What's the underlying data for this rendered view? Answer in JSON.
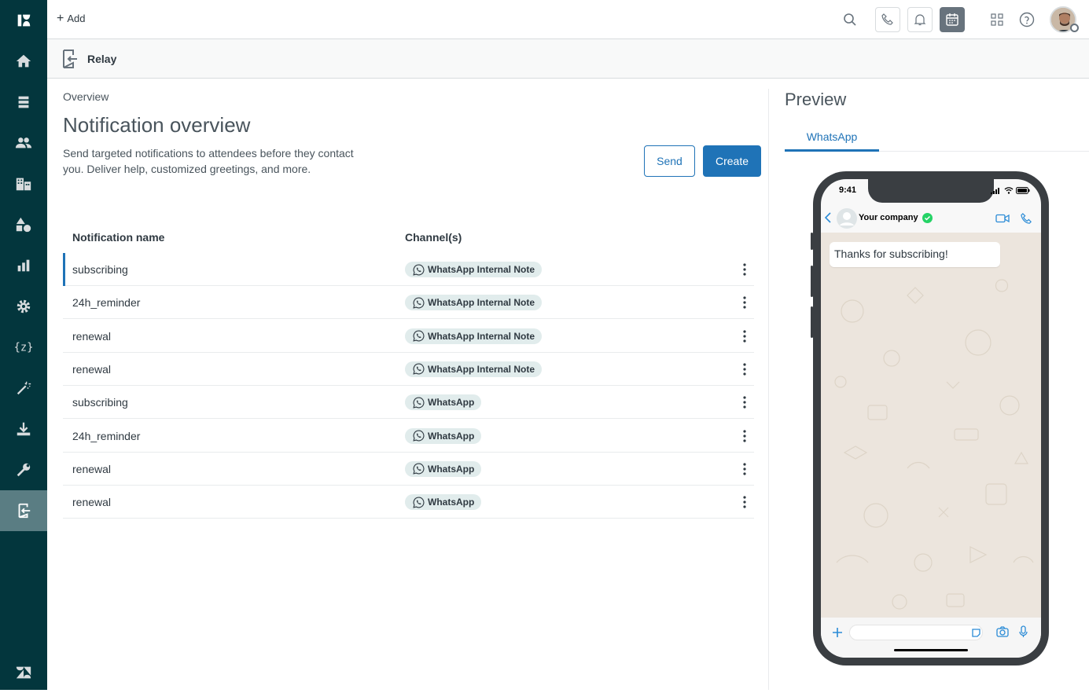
{
  "topbar": {
    "add_label": "Add"
  },
  "subheader": {
    "title": "Relay"
  },
  "main": {
    "breadcrumb": "Overview",
    "title": "Notification overview",
    "description": "Send targeted notifications to attendees before they contact you. Deliver help, customized greetings, and more.",
    "send_label": "Send",
    "create_label": "Create"
  },
  "table": {
    "headers": [
      "Notification name",
      "Channel(s)"
    ],
    "rows": [
      {
        "name": "subscribing",
        "channel": "WhatsApp Internal Note"
      },
      {
        "name": "24h_reminder",
        "channel": "WhatsApp Internal Note"
      },
      {
        "name": "renewal",
        "channel": "WhatsApp Internal Note"
      },
      {
        "name": "renewal",
        "channel": "WhatsApp Internal Note"
      },
      {
        "name": "subscribing",
        "channel": "WhatsApp"
      },
      {
        "name": "24h_reminder",
        "channel": "WhatsApp"
      },
      {
        "name": "renewal",
        "channel": "WhatsApp"
      },
      {
        "name": "renewal",
        "channel": "WhatsApp"
      }
    ]
  },
  "preview": {
    "title": "Preview",
    "tabs": [
      "WhatsApp"
    ],
    "phone": {
      "time": "9:41",
      "contact": "Your company",
      "message": "Thanks for subscribing!"
    }
  },
  "colors": {
    "nav_bg": "#03363d",
    "nav_active": "#5a7d83",
    "primary": "#1f73b7",
    "tag_bg": "#e1ecec",
    "verified": "#25d366"
  },
  "icons": {
    "nav": [
      "zendesk-logo-icon",
      "home-icon",
      "views-icon",
      "customers-icon",
      "organizations-icon",
      "objects-icon",
      "reporting-icon",
      "admin-gear-icon",
      "liquid-placeholder-icon",
      "magic-wand-icon",
      "download-icon",
      "wrench-icon",
      "relay-icon",
      "zendesk-z-icon"
    ],
    "topbar": [
      "search-icon",
      "phone-icon",
      "bell-icon",
      "calendar-icon",
      "apps-grid-icon",
      "help-icon"
    ]
  }
}
